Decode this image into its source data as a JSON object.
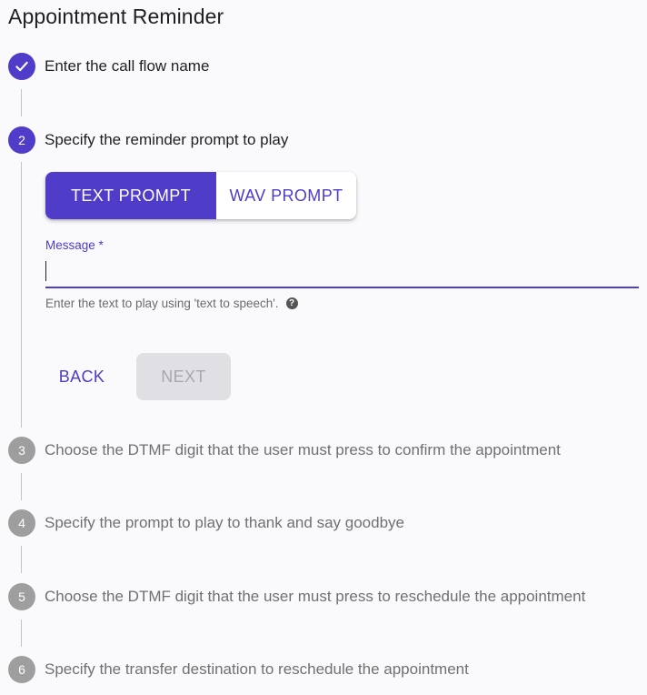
{
  "page": {
    "title": "Appointment Reminder"
  },
  "colors": {
    "accent": "#4f3cc9",
    "inactive": "#9e9e9e",
    "disabled_bg": "#e0e0e4"
  },
  "steps": [
    {
      "marker": "",
      "icon": "check-icon",
      "label": "Enter the call flow name",
      "state": "completed"
    },
    {
      "marker": "2",
      "label": "Specify the reminder prompt to play",
      "state": "active"
    },
    {
      "marker": "3",
      "label": "Choose the DTMF digit that the user must press to confirm the appointment",
      "state": "inactive"
    },
    {
      "marker": "4",
      "label": "Specify the prompt to play to thank and say goodbye",
      "state": "inactive"
    },
    {
      "marker": "5",
      "label": "Choose the DTMF digit that the user must press to reschedule the appointment",
      "state": "inactive"
    },
    {
      "marker": "6",
      "label": "Specify the transfer destination to reschedule the appointment",
      "state": "inactive"
    }
  ],
  "prompt_toggle": {
    "options": [
      "TEXT PROMPT",
      "WAV PROMPT"
    ],
    "selected": "TEXT PROMPT"
  },
  "message_field": {
    "label": "Message *",
    "value": "",
    "helper": "Enter the text to play using 'text to speech'.",
    "help_icon": "help-circle-icon"
  },
  "actions": {
    "back_label": "BACK",
    "next_label": "NEXT"
  }
}
